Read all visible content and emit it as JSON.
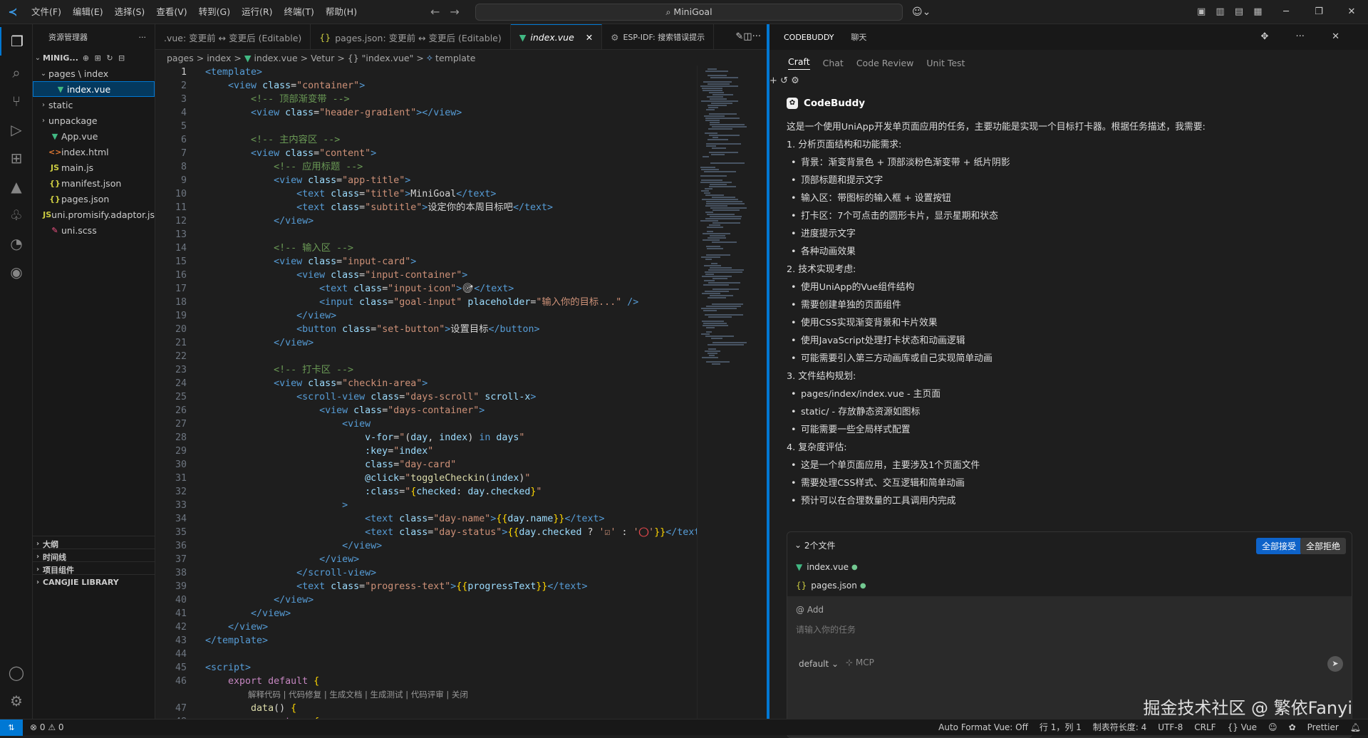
{
  "titlebar": {
    "menu": [
      "文件(F)",
      "编辑(E)",
      "选择(S)",
      "查看(V)",
      "转到(G)",
      "运行(R)",
      "终端(T)",
      "帮助(H)"
    ],
    "search": "MiniGoal"
  },
  "sidebar": {
    "title": "资源管理器",
    "root": "MINIG...",
    "items": [
      {
        "label": "pages \\ index",
        "type": "folder-open",
        "indent": 1
      },
      {
        "label": "index.vue",
        "type": "vue",
        "indent": 2,
        "selected": true
      },
      {
        "label": "static",
        "type": "folder",
        "indent": 1
      },
      {
        "label": "unpackage",
        "type": "folder",
        "indent": 1
      },
      {
        "label": "App.vue",
        "type": "vue",
        "indent": 1
      },
      {
        "label": "index.html",
        "type": "html",
        "indent": 1
      },
      {
        "label": "main.js",
        "type": "js",
        "indent": 1
      },
      {
        "label": "manifest.json",
        "type": "json",
        "indent": 1
      },
      {
        "label": "pages.json",
        "type": "json",
        "indent": 1
      },
      {
        "label": "uni.promisify.adaptor.js",
        "type": "js",
        "indent": 1
      },
      {
        "label": "uni.scss",
        "type": "scss",
        "indent": 1
      }
    ],
    "sections": [
      "大纲",
      "时间线",
      "项目组件",
      "CANGJIE LIBRARY"
    ]
  },
  "tabs": [
    {
      "label": ".vue: 变更前 ↔ 变更后 (Editable)"
    },
    {
      "label": "pages.json: 变更前 ↔ 变更后 (Editable)"
    },
    {
      "label": "index.vue",
      "active": true
    },
    {
      "label": "ESP-IDF: 搜索错误提示"
    }
  ],
  "breadcrumb": [
    "pages",
    ">",
    "index",
    ">",
    "index.vue",
    ">",
    "Vetur",
    ">",
    "{} \"index.vue\"",
    ">",
    "template"
  ],
  "codelens": "解释代码 | 代码修复 | 生成文档 | 生成测试 | 代码评审 | 关闭",
  "panel": {
    "tabs": [
      "CODEBUDDY",
      "聊天"
    ],
    "subtabs": [
      "Craft",
      "Chat",
      "Code Review",
      "Unit Test"
    ],
    "title": "CodeBuddy",
    "messages": [
      {
        "t": "这是一个使用UniApp开发单页面应用的任务，主要功能是实现一个目标打卡器。根据任务描述，我需要:",
        "b": false
      },
      {
        "t": "1. 分析页面结构和功能需求:",
        "b": false
      },
      {
        "t": "背景：渐变背景色 + 顶部淡粉色渐变带 + 纸片阴影",
        "b": true
      },
      {
        "t": "顶部标题和提示文字",
        "b": true
      },
      {
        "t": "输入区：带图标的输入框 + 设置按钮",
        "b": true
      },
      {
        "t": "打卡区：7个可点击的圆形卡片，显示星期和状态",
        "b": true
      },
      {
        "t": "进度提示文字",
        "b": true
      },
      {
        "t": "各种动画效果",
        "b": true
      },
      {
        "t": "2. 技术实现考虑:",
        "b": false
      },
      {
        "t": "使用UniApp的Vue组件结构",
        "b": true
      },
      {
        "t": "需要创建单独的页面组件",
        "b": true
      },
      {
        "t": "使用CSS实现渐变背景和卡片效果",
        "b": true
      },
      {
        "t": "使用JavaScript处理打卡状态和动画逻辑",
        "b": true
      },
      {
        "t": "可能需要引入第三方动画库或自己实现简单动画",
        "b": true
      },
      {
        "t": "3. 文件结构规划:",
        "b": false
      },
      {
        "t": "pages/index/index.vue - 主页面",
        "b": true
      },
      {
        "t": "static/ - 存放静态资源如图标",
        "b": true
      },
      {
        "t": "可能需要一些全局样式配置",
        "b": true
      },
      {
        "t": "4. 复杂度评估:",
        "b": false
      },
      {
        "t": "这是一个单页面应用，主要涉及1个页面文件",
        "b": true
      },
      {
        "t": "需要处理CSS样式、交互逻辑和简单动画",
        "b": true
      },
      {
        "t": "预计可以在合理数量的工具调用内完成",
        "b": true
      }
    ],
    "files_header": "2个文件",
    "accept_all": "全部接受",
    "reject_all": "全部拒绝",
    "files": [
      "index.vue",
      "pages.json"
    ],
    "add": "@ Add",
    "input_placeholder": "请输入你的任务",
    "mode": "default",
    "mcp": "MCP"
  },
  "watermark": "掘金技术社区 @ 繁依Fanyi",
  "statusbar": {
    "problems": "⊗ 0 ⚠ 0",
    "items": [
      "Auto Format Vue: Off",
      "行 1，列 1",
      "制表符长度: 4",
      "UTF-8",
      "CRLF",
      "{} Vue",
      "Prettier"
    ]
  },
  "colors": {
    "accent": "#0078d4",
    "vue": "#41b883",
    "json": "#cbcb41"
  }
}
